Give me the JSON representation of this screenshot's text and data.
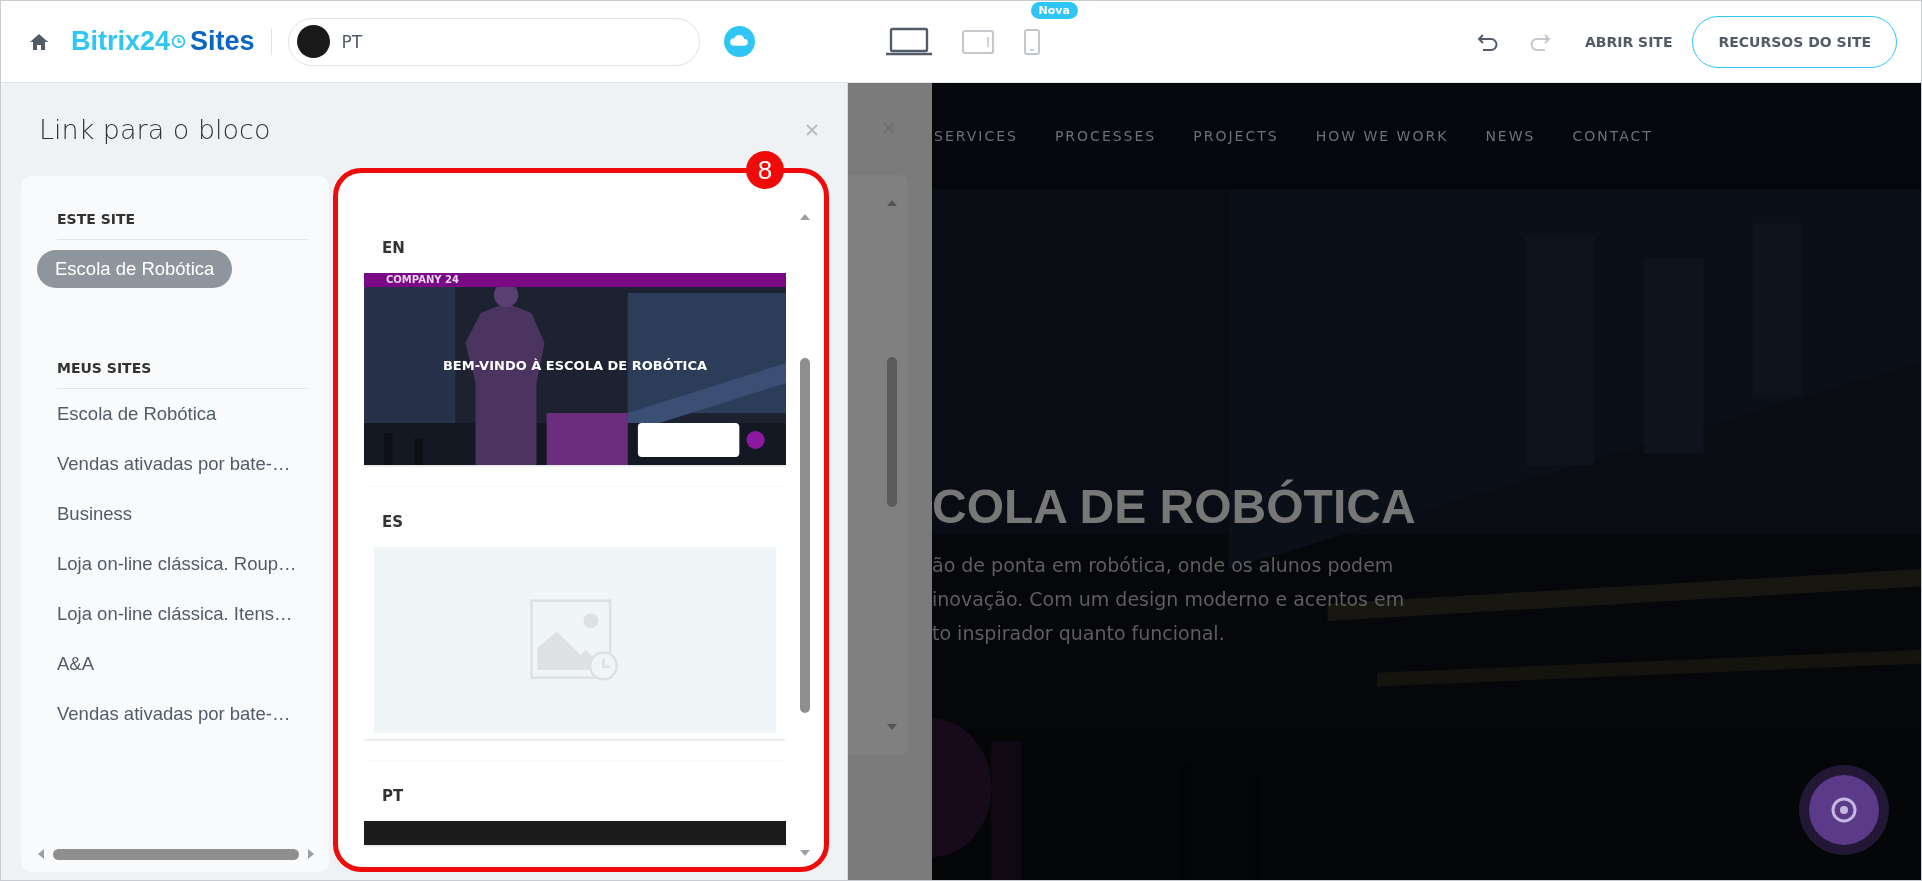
{
  "top_bar": {
    "logo": {
      "brand": "Bitrix24",
      "product": "Sites"
    },
    "language_select": {
      "value": "PT"
    },
    "devices": [
      {
        "kind": "desktop",
        "selected": true
      },
      {
        "kind": "tablet",
        "selected": false
      },
      {
        "kind": "mobile",
        "selected": false,
        "badge": "Nova"
      }
    ],
    "history": [
      {
        "kind": "undo",
        "disabled": false
      },
      {
        "kind": "redo",
        "disabled": true
      }
    ],
    "open_link": "ABRIR SITE",
    "resources_button": "RECURSOS DO SITE"
  },
  "panel": {
    "title": "Link para o bloco",
    "sections": [
      {
        "heading": "ESTE SITE",
        "items": [
          {
            "label": "Escola de Robótica",
            "selected": true
          }
        ]
      },
      {
        "heading": "MEUS SITES",
        "items": [
          {
            "label": "Escola de Robótica",
            "selected": false
          },
          {
            "label": "Vendas ativadas por bate-…",
            "selected": false
          },
          {
            "label": "Business",
            "selected": false
          },
          {
            "label": "Loja on-line clássica. Roup…",
            "selected": false
          },
          {
            "label": "Loja on-line clássica. Itens…",
            "selected": false
          },
          {
            "label": "A&A",
            "selected": false
          },
          {
            "label": "Vendas ativadas por bate-…",
            "selected": false
          }
        ]
      }
    ],
    "pages": [
      {
        "label": "EN",
        "preview": {
          "kind": "site",
          "brand": "COMPANY 24",
          "headline": "BEM-VINDO À ESCOLA DE ROBÓTICA"
        }
      },
      {
        "label": "ES",
        "preview": {
          "kind": "empty"
        }
      },
      {
        "label": "PT",
        "preview": {
          "kind": "dark"
        }
      }
    ]
  },
  "annotation": {
    "badge": "8"
  },
  "background_site": {
    "nav": [
      "SERVICES",
      "PROCESSES",
      "PROJECTS",
      "HOW WE WORK",
      "NEWS",
      "CONTACT"
    ],
    "heading": "COLA DE ROBÓTICA",
    "text_lines": [
      "ão de ponta em robótica, onde os alunos podem",
      "inovação. Com um design moderno e acentos em",
      "to inspirador quanto funcional."
    ]
  }
}
